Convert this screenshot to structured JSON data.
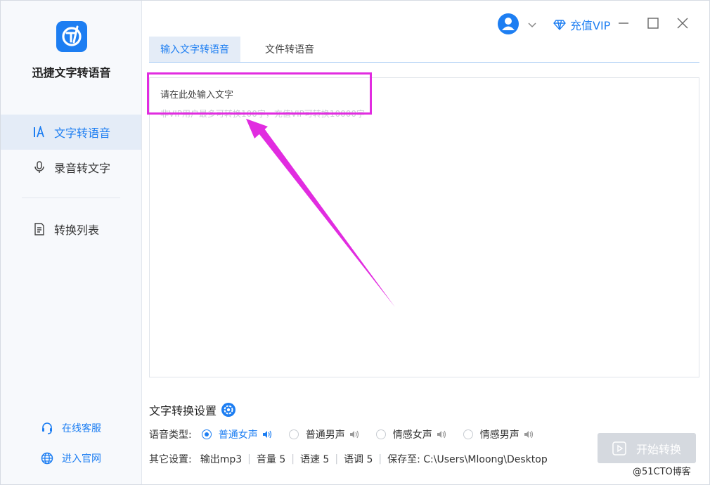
{
  "app": {
    "name": "迅捷文字转语音"
  },
  "sidebar": {
    "items": [
      {
        "label": "文字转语音",
        "icon": "text-icon",
        "active": true
      },
      {
        "label": "录音转文字",
        "icon": "microphone-icon",
        "active": false
      },
      {
        "label": "转换列表",
        "icon": "list-document-icon",
        "active": false
      }
    ],
    "footer": [
      {
        "label": "在线客服",
        "icon": "headset-icon"
      },
      {
        "label": "进入官网",
        "icon": "globe-icon"
      }
    ]
  },
  "header": {
    "vip_label": "充值VIP"
  },
  "tabs": [
    {
      "label": "输入文字转语音",
      "active": true
    },
    {
      "label": "文件转语音",
      "active": false
    }
  ],
  "editor": {
    "title": "请在此处输入文字",
    "hint": "非VIP用户最多可转换100字，充值VIP可转换10000字"
  },
  "settings": {
    "title": "文字转换设置",
    "voice_label": "语音类型:",
    "voices": [
      {
        "label": "普通女声",
        "selected": true
      },
      {
        "label": "普通男声",
        "selected": false
      },
      {
        "label": "情感女声",
        "selected": false
      },
      {
        "label": "情感男声",
        "selected": false
      }
    ],
    "other_label": "其它设置:",
    "output": "输出mp3",
    "volume": "音量 5",
    "speed": "语速 5",
    "tone": "语调 5",
    "save_path": "保存至: C:\\Users\\Mloong\\Desktop"
  },
  "start_button": {
    "label": "开始转换"
  },
  "watermark": "@51CTO博客",
  "colors": {
    "accent": "#1d7ef2",
    "highlight": "#e12ce0",
    "disabled": "#d5d9df"
  }
}
